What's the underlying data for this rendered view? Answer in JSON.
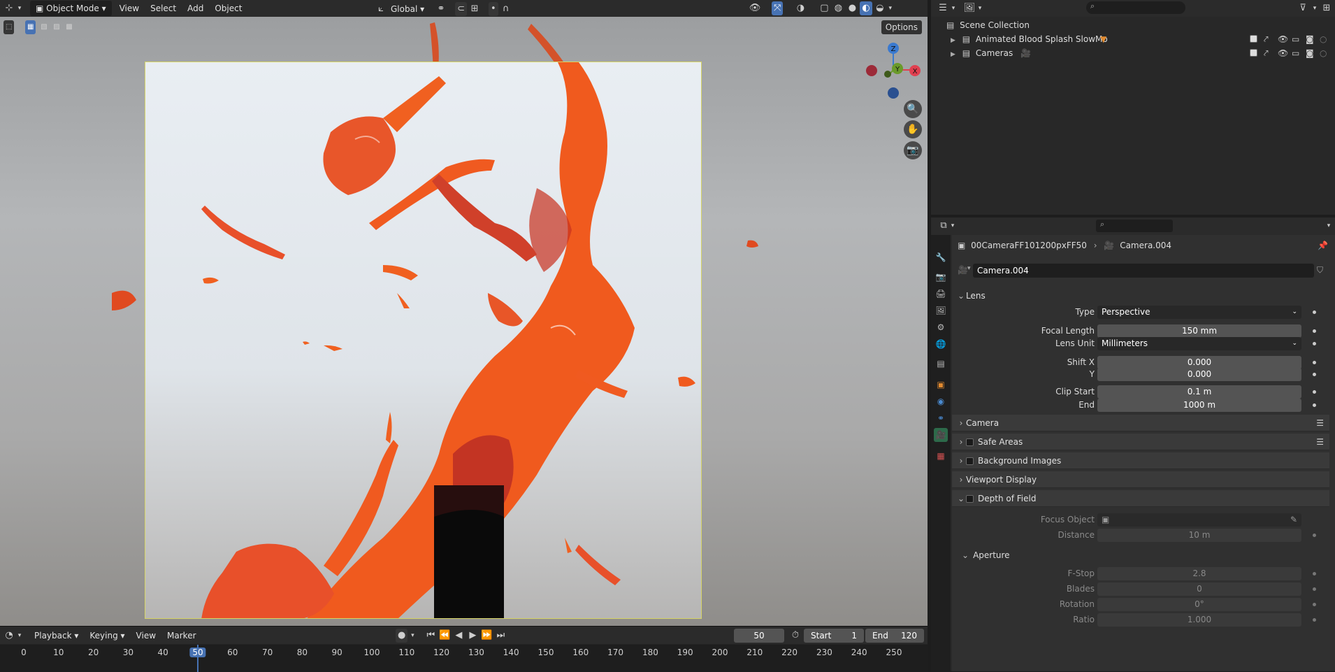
{
  "viewport": {
    "mode_label": "Object Mode",
    "menu": [
      "View",
      "Select",
      "Add",
      "Object"
    ],
    "transform_orientation": "Global",
    "options_label": "Options",
    "gizmo_axes": {
      "x": "X",
      "y": "Y",
      "z": "Z"
    }
  },
  "timeline": {
    "menu": [
      "Playback",
      "Keying",
      "View",
      "Marker"
    ],
    "current_frame": "50",
    "start_label": "Start",
    "start_value": "1",
    "end_label": "End",
    "end_value": "120",
    "ruler": [
      "0",
      "10",
      "20",
      "30",
      "40",
      "50",
      "60",
      "70",
      "80",
      "90",
      "100",
      "110",
      "120",
      "130",
      "140",
      "150",
      "160",
      "170",
      "180",
      "190",
      "200",
      "210",
      "220",
      "230",
      "240",
      "250"
    ]
  },
  "outliner": {
    "root": "Scene Collection",
    "items": [
      {
        "label": "Animated Blood Splash SlowMo"
      },
      {
        "label": "Cameras"
      }
    ]
  },
  "properties": {
    "breadcrumb_object": "00CameraFF101200pxFF50",
    "breadcrumb_data": "Camera.004",
    "datablock_name": "Camera.004",
    "lens": {
      "title": "Lens",
      "type_label": "Type",
      "type_value": "Perspective",
      "focal_label": "Focal Length",
      "focal_value": "150 mm",
      "unit_label": "Lens Unit",
      "unit_value": "Millimeters",
      "shiftx_label": "Shift X",
      "shiftx_value": "0.000",
      "shifty_label": "Y",
      "shifty_value": "0.000",
      "clipstart_label": "Clip Start",
      "clipstart_value": "0.1 m",
      "clipend_label": "End",
      "clipend_value": "1000 m"
    },
    "sections": {
      "camera": "Camera",
      "safe_areas": "Safe Areas",
      "background_images": "Background Images",
      "viewport_display": "Viewport Display",
      "dof": "Depth of Field"
    },
    "dof": {
      "focus_object_label": "Focus Object",
      "distance_label": "Distance",
      "distance_value": "10 m",
      "aperture_title": "Aperture",
      "fstop_label": "F-Stop",
      "fstop_value": "2.8",
      "blades_label": "Blades",
      "blades_value": "0",
      "rotation_label": "Rotation",
      "rotation_value": "0°",
      "ratio_label": "Ratio",
      "ratio_value": "1.000"
    }
  },
  "colors": {
    "accent_blue": "#4772b3",
    "camera_frame": "#d6d466",
    "splash": "#f0501e",
    "axis_x": "#e04050",
    "axis_y": "#6a9a2a",
    "axis_z": "#3a7ad0"
  }
}
